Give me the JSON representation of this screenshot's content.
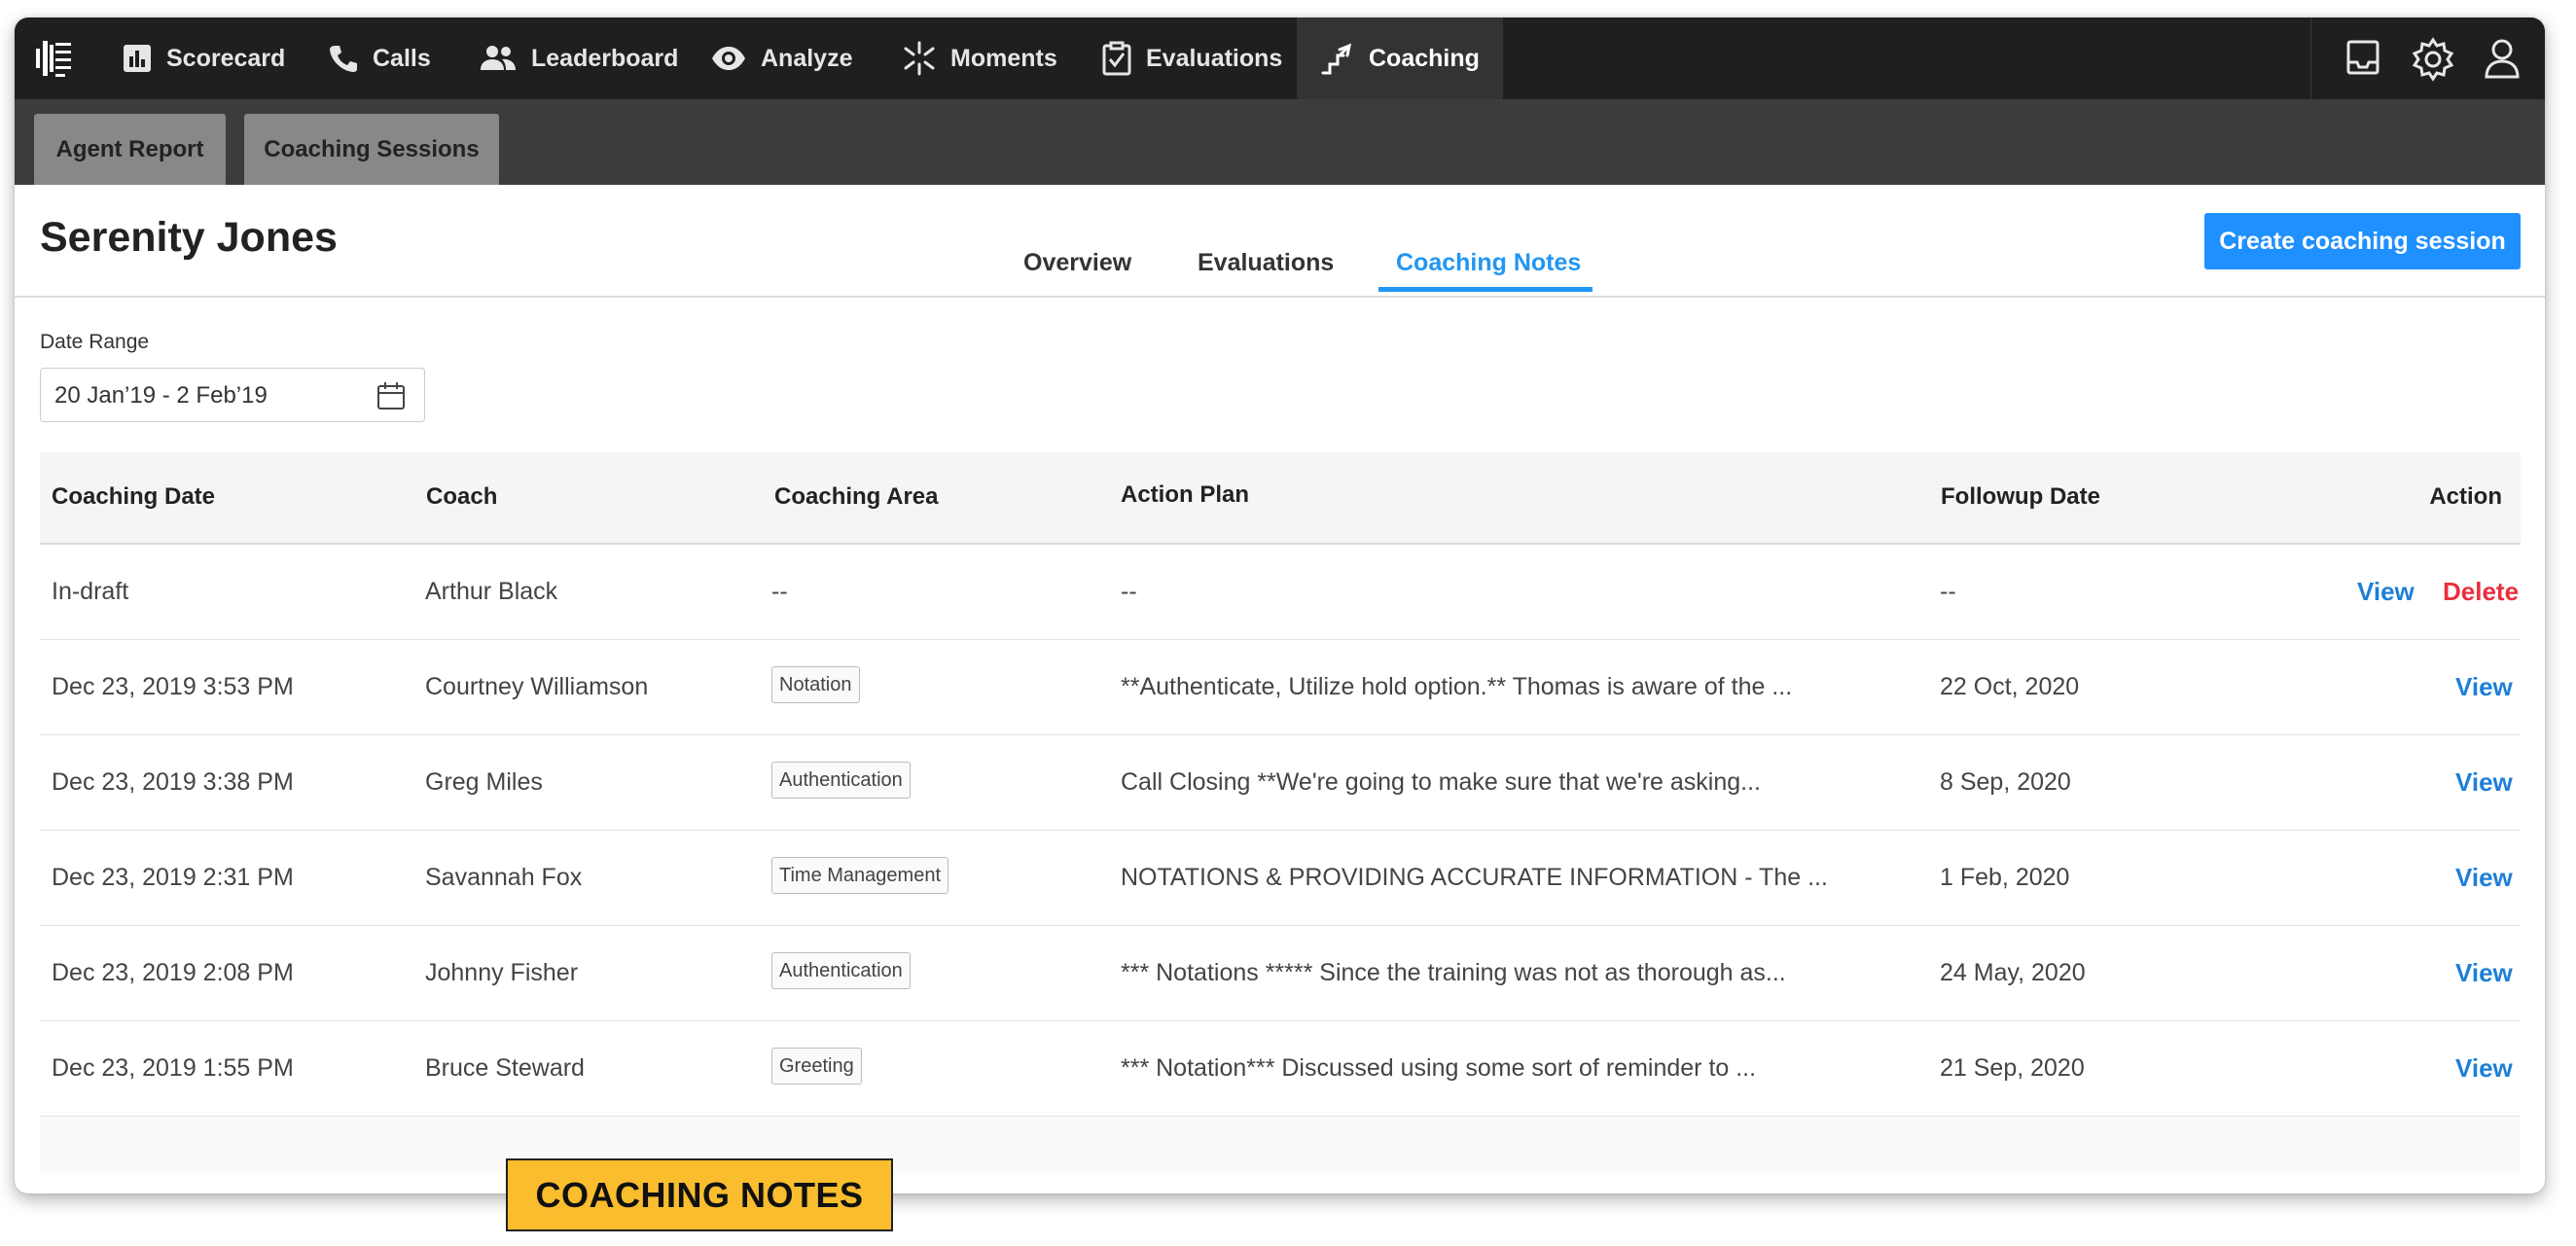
{
  "topnav": {
    "items": [
      {
        "label": "Scorecard",
        "icon": "bar-chart-icon"
      },
      {
        "label": "Calls",
        "icon": "phone-icon"
      },
      {
        "label": "Leaderboard",
        "icon": "people-icon"
      },
      {
        "label": "Analyze",
        "icon": "eye-icon"
      },
      {
        "label": "Moments",
        "icon": "sparkle-icon"
      },
      {
        "label": "Evaluations",
        "icon": "clipboard-check-icon"
      },
      {
        "label": "Coaching",
        "icon": "stairs-arrow-icon"
      }
    ],
    "active": "Coaching",
    "right_icons": [
      "inbox-icon",
      "gear-icon",
      "user-icon"
    ]
  },
  "subnav": {
    "tabs": [
      {
        "label": "Agent Report"
      },
      {
        "label": "Coaching Sessions"
      }
    ]
  },
  "header": {
    "agent_name": "Serenity Jones",
    "tabs": [
      {
        "label": "Overview"
      },
      {
        "label": "Evaluations"
      },
      {
        "label": "Coaching Notes"
      }
    ],
    "active_tab": "Coaching Notes",
    "create_button": "Create coaching session"
  },
  "date_range": {
    "label": "Date Range",
    "value": "20 Jan’19 - 2 Feb’19",
    "icon": "calendar-icon"
  },
  "table": {
    "columns": [
      "Coaching Date",
      "Coach",
      "Coaching Area",
      "Action Plan",
      "Followup Date",
      "Action"
    ],
    "rows": [
      {
        "date": "In-draft",
        "coach": "Arthur Black",
        "area": "--",
        "plan": "--",
        "followup": "--",
        "view": "View",
        "delete": "Delete"
      },
      {
        "date": "Dec 23, 2019 3:53 PM",
        "coach": "Courtney Williamson",
        "area": "Notation",
        "plan": "**Authenticate, Utilize hold option.**   Thomas is aware of the ...",
        "followup": "22 Oct, 2020",
        "view": "View"
      },
      {
        "date": "Dec 23, 2019 3:38 PM",
        "coach": "Greg Miles",
        "area": "Authentication",
        "plan": "Call Closing **We're going to make sure that we're asking...",
        "followup": "8 Sep, 2020",
        "view": "View"
      },
      {
        "date": "Dec 23, 2019 2:31 PM",
        "coach": "Savannah Fox",
        "area": "Time Management",
        "plan": "NOTATIONS & PROVIDING ACCURATE INFORMATION - The ...",
        "followup": "1 Feb, 2020",
        "view": "View"
      },
      {
        "date": "Dec 23, 2019 2:08 PM",
        "coach": "Johnny Fisher",
        "area": "Authentication",
        "plan": "*** Notations ***** Since the training was not as thorough as...",
        "followup": "24 May, 2020",
        "view": "View"
      },
      {
        "date": "Dec 23, 2019 1:55 PM",
        "coach": "Bruce Steward",
        "area": "Greeting",
        "plan": "*** Notation*** Discussed using some sort of reminder to ...",
        "followup": "21 Sep, 2020",
        "view": "View"
      }
    ]
  },
  "caption": "COACHING NOTES",
  "colors": {
    "topnav_bg": "#1f1f1f",
    "subnav_bg": "#3c3c3c",
    "accent": "#2196f3",
    "link": "#1e7fd8",
    "delete": "#e8303e",
    "caption_bg": "#f9bd2e"
  }
}
